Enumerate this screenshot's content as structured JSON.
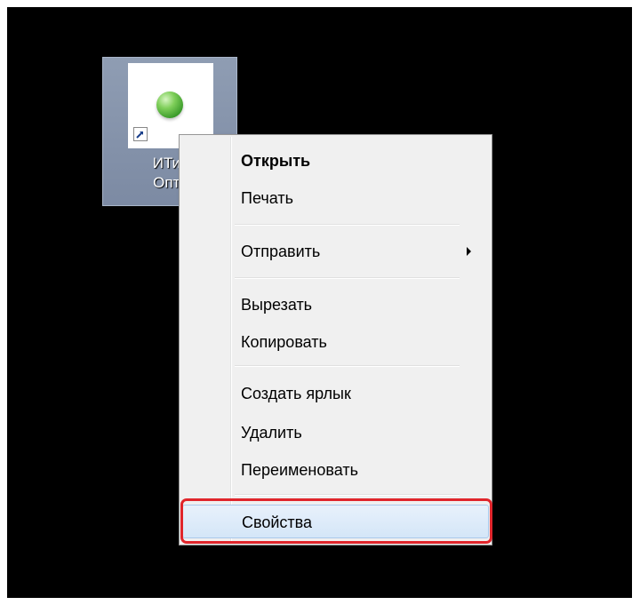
{
  "desktop_icon": {
    "label": "ИТип\nОпти",
    "icon": "green-globe-icon",
    "overlay_icon": "shortcut-arrow-icon"
  },
  "context_menu": {
    "items": [
      {
        "label": "Открыть",
        "bold": true
      },
      {
        "label": "Печать"
      },
      {
        "label": "Отправить",
        "has_submenu": true
      },
      {
        "label": "Вырезать"
      },
      {
        "label": "Копировать"
      },
      {
        "label": "Создать ярлык"
      },
      {
        "label": "Удалить"
      },
      {
        "label": "Переименовать"
      },
      {
        "label": "Свойства",
        "highlighted": true
      }
    ]
  },
  "colors": {
    "desktop_background": "#000000",
    "menu_background": "#f0f0f0",
    "highlight_ring": "#e0252b"
  }
}
